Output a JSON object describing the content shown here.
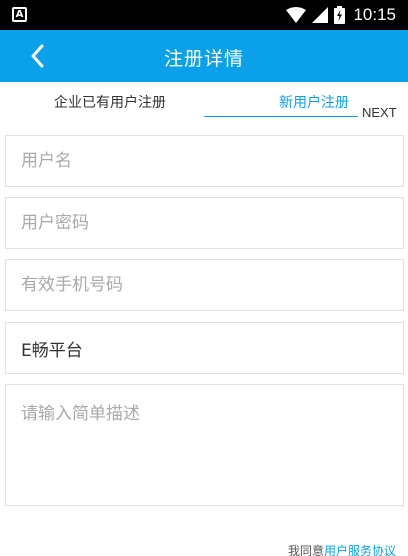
{
  "status_bar": {
    "time": "10:15",
    "notification_icon": "A",
    "icons": [
      "wifi-icon",
      "signal-icon",
      "battery-icon"
    ]
  },
  "app_bar": {
    "title": "注册详情",
    "back_icon": "chevron-left-icon"
  },
  "tabs": {
    "existing_user": "企业已有用户注册",
    "new_user": "新用户注册",
    "active": "new_user",
    "next": "NEXT"
  },
  "form": {
    "username": {
      "placeholder": "用户名",
      "value": ""
    },
    "password": {
      "placeholder": "用户密码",
      "value": ""
    },
    "phone": {
      "placeholder": "有效手机号码",
      "value": ""
    },
    "platform": {
      "placeholder": "",
      "value": "E畅平台"
    },
    "description": {
      "placeholder": "请输入简单描述",
      "value": ""
    }
  },
  "agreement": {
    "prefix": "我同意",
    "link": "用户服务协议"
  },
  "colors": {
    "primary": "#0AA1EA",
    "status_bar": "#000000",
    "field_border": "#e1e1e1",
    "placeholder": "#a9a9a9"
  }
}
